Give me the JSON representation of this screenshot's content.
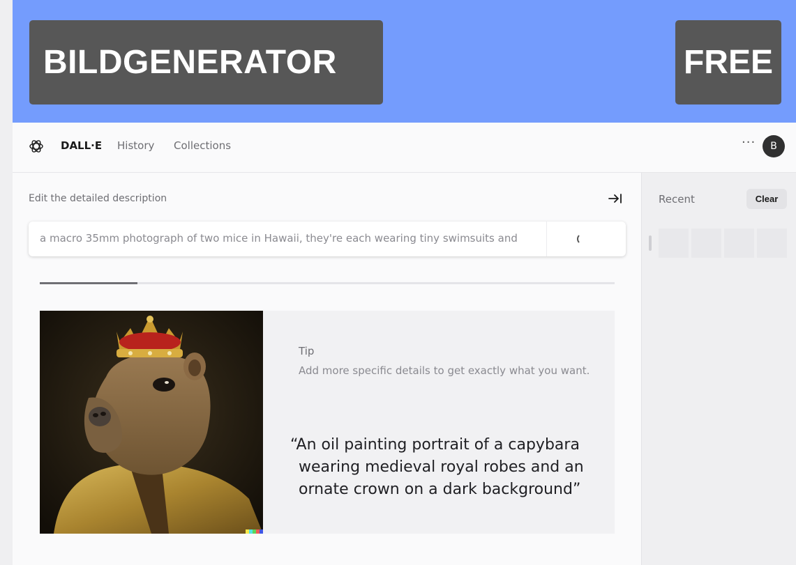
{
  "banner": {
    "title": "BILDGENERATOR",
    "badge": "FREE"
  },
  "nav": {
    "logo_icon": "openai-logo-icon",
    "brand": "DALL·E",
    "history": "History",
    "collections": "Collections",
    "more": "···",
    "avatar_initial": "B"
  },
  "editor": {
    "label": "Edit the detailed description",
    "collapse_icon": "arrow-right-to-bar-icon",
    "prompt_value": "a macro 35mm photograph of two mice in Hawaii, they're each wearing tiny swimsuits and",
    "loading_icon": "spinner-icon",
    "progress_percent": 17
  },
  "example": {
    "tip_title": "Tip",
    "tip_body": "Add more specific details to get exactly what you want.",
    "quote_lines": [
      "“An oil painting portrait of a capybara",
      "wearing medieval royal robes and an",
      "ornate crown on a dark background”"
    ],
    "badge_colors": [
      "#f7e94b",
      "#52e2e3",
      "#5cd55a",
      "#f05a57",
      "#3f55e4"
    ]
  },
  "sidebar": {
    "recent_label": "Recent",
    "clear_label": "Clear",
    "thumb_count": 4
  },
  "colors": {
    "banner_bg": "#749cfd",
    "banner_box": "#575757",
    "avatar_bg": "#303030"
  }
}
